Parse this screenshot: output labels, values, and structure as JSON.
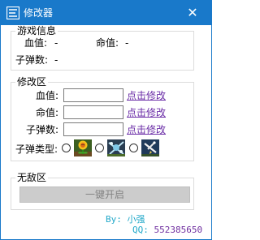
{
  "window": {
    "title": "修改器",
    "close_symbol": "✕",
    "icon": "app-logo-icon"
  },
  "info": {
    "legend": "游戏信息",
    "blood_label": "血值:",
    "blood_value": "-",
    "life_label": "命值:",
    "life_value": "-",
    "ammo_label": "子弹数:",
    "ammo_value": "-"
  },
  "modify": {
    "legend": "修改区",
    "rows": [
      {
        "label": "血值:",
        "value": "",
        "link": "点击修改"
      },
      {
        "label": "命值:",
        "value": "",
        "link": "点击修改"
      },
      {
        "label": "子弹数:",
        "value": "",
        "link": "点击修改"
      }
    ],
    "bullet_type_label": "子弹类型:",
    "bullet_types": [
      "sunflower-plant-icon",
      "snow-pea-plant-icon",
      "starfruit-plant-icon"
    ]
  },
  "invincible": {
    "legend": "无敌区",
    "button_label": "一键开启"
  },
  "credits": {
    "by_label": "By: 小强",
    "qq_label": "QQ:",
    "qq_number": "552385650"
  },
  "colors": {
    "titlebar": "#1979ca",
    "link": "#6b2ea7",
    "credit": "#21a8c9",
    "qq_number": "#7030a0"
  }
}
